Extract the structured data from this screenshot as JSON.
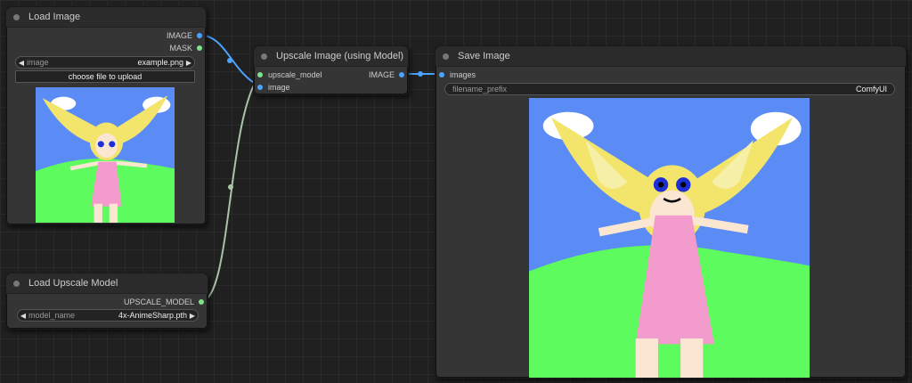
{
  "nodes": {
    "load_image": {
      "title": "Load Image",
      "outputs": [
        "IMAGE",
        "MASK"
      ],
      "image_label": "image",
      "image_value": "example.png",
      "upload_label": "choose file to upload"
    },
    "load_upscale": {
      "title": "Load Upscale Model",
      "output": "UPSCALE_MODEL",
      "model_label": "model_name",
      "model_value": "4x-AnimeSharp.pth"
    },
    "upscale": {
      "title": "Upscale Image (using Model)",
      "inputs": [
        "upscale_model",
        "image"
      ],
      "output": "IMAGE"
    },
    "save": {
      "title": "Save Image",
      "input": "images",
      "prefix_label": "filename_prefix",
      "prefix_value": "ComfyUI"
    }
  },
  "colors": {
    "image_port": "#4aa3ff",
    "model_port": "#7ee38a",
    "mask_port": "#7ee38a",
    "wire_image": "#4aa3ff",
    "wire_model": "#a8c4a8"
  }
}
